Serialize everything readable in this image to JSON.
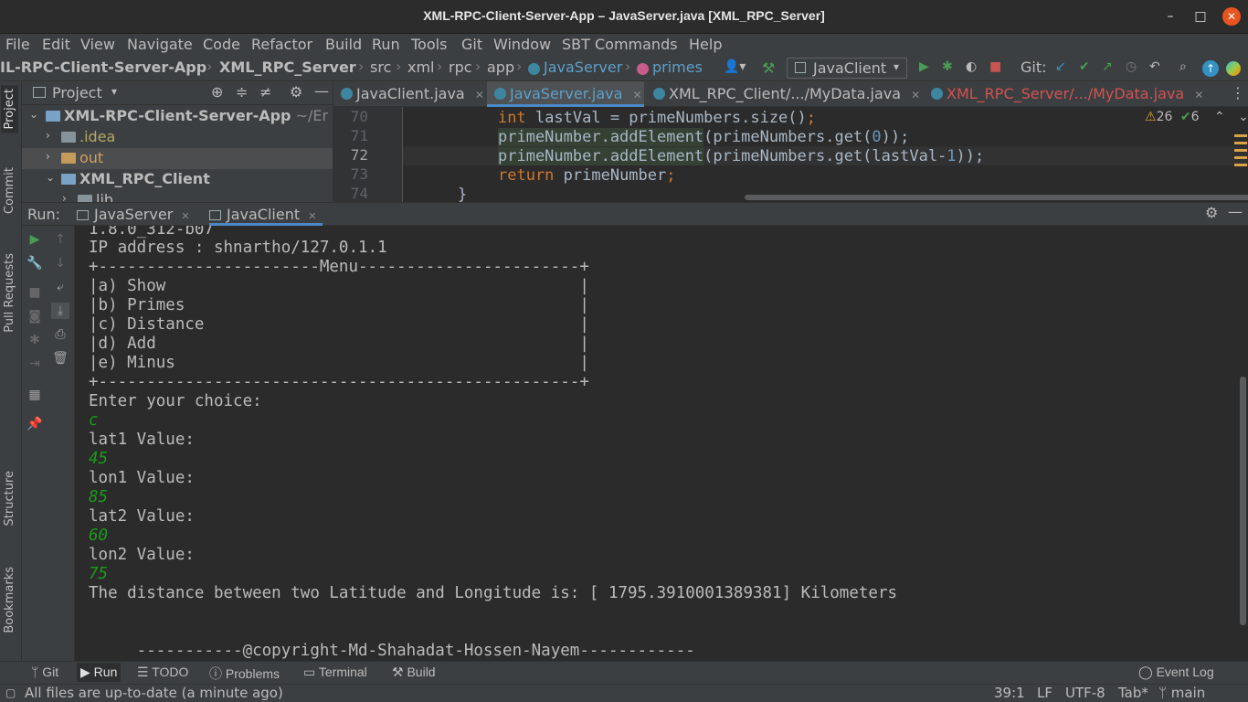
{
  "window": {
    "title": "XML-RPC-Client-Server-App – JavaServer.java [XML_RPC_Server]",
    "minimize": "–",
    "maximize": "□",
    "close": "✕"
  },
  "menu": [
    "File",
    "Edit",
    "View",
    "Navigate",
    "Code",
    "Refactor",
    "Build",
    "Run",
    "Tools",
    "Git",
    "Window",
    "SBT Commands",
    "Help"
  ],
  "breadcrumb": {
    "project": "IL-RPC-Client-Server-App",
    "module": "XML_RPC_Server",
    "parts": [
      "src",
      "xml",
      "rpc",
      "app"
    ],
    "class": "JavaServer",
    "method": "primes"
  },
  "toolbar": {
    "run_config": "JavaClient",
    "git_label": "Git:"
  },
  "left_tabs": [
    "Project",
    "Commit",
    "Pull Requests",
    "Structure",
    "Bookmarks"
  ],
  "project_panel": {
    "title": "Project",
    "tree": [
      {
        "label": "XML-RPC-Client-Server-App",
        "suffix": "~/Er",
        "bold": true,
        "expanded": true
      },
      {
        "label": ".idea",
        "expanded": false
      },
      {
        "label": "out",
        "expanded": false
      },
      {
        "label": "XML_RPC_Client",
        "bold": true,
        "expanded": true
      },
      {
        "label": "lib",
        "expanded": false
      }
    ]
  },
  "editor": {
    "tabs": [
      {
        "label": "JavaClient.java"
      },
      {
        "label": "JavaServer.java"
      },
      {
        "label": "XML_RPC_Client/.../MyData.java"
      },
      {
        "label": "XML_RPC_Server/.../MyData.java"
      }
    ],
    "line_numbers": [
      "70",
      "71",
      "72",
      "73",
      "74"
    ],
    "warnings": "26",
    "checks": "6",
    "lines": {
      "l70_kw": "int",
      "l70_rest": " lastVal = primeNumbers.size()",
      "l71_a": "primeNumber.addElement",
      "l71_b": "(primeNumbers.get(",
      "l71_num": "0",
      "l71_c": "));",
      "l72_a": "primeNumber.addElement",
      "l72_b": "(primeNumbers.get",
      "l72_c": "(lastVal-",
      "l72_num": "1",
      "l72_d": "));",
      "l73_kw": "return",
      "l73_rest": " primeNumber",
      "l74": "}"
    }
  },
  "run_panel": {
    "label": "Run:",
    "tabs": [
      "JavaServer",
      "JavaClient"
    ]
  },
  "console": {
    "lines": [
      {
        "text": "1.8.0_312-b07",
        "type": "out"
      },
      {
        "text": "IP address : shnartho/127.0.1.1",
        "type": "out"
      },
      {
        "text": "+-----------------------Menu-----------------------+",
        "type": "out"
      },
      {
        "text": "|a) Show                                           |",
        "type": "out"
      },
      {
        "text": "|b) Primes                                         |",
        "type": "out"
      },
      {
        "text": "|c) Distance                                       |",
        "type": "out"
      },
      {
        "text": "|d) Add                                            |",
        "type": "out"
      },
      {
        "text": "|e) Minus                                          |",
        "type": "out"
      },
      {
        "text": "+--------------------------------------------------+",
        "type": "out"
      },
      {
        "text": "Enter your choice:",
        "type": "out"
      },
      {
        "text": "c",
        "type": "in"
      },
      {
        "text": "lat1 Value:",
        "type": "out"
      },
      {
        "text": "45",
        "type": "in"
      },
      {
        "text": "lon1 Value:",
        "type": "out"
      },
      {
        "text": "85",
        "type": "in"
      },
      {
        "text": "lat2 Value:",
        "type": "out"
      },
      {
        "text": "60",
        "type": "in"
      },
      {
        "text": "lon2 Value:",
        "type": "out"
      },
      {
        "text": "75",
        "type": "in"
      },
      {
        "text": "The distance between two Latitude and Longitude is: [ 1795.3910001389381] Kilometers",
        "type": "out"
      },
      {
        "text": "",
        "type": "out"
      },
      {
        "text": "",
        "type": "out"
      },
      {
        "text": "     -----------@copyright-Md-Shahadat-Hossen-Nayem------------",
        "type": "out"
      }
    ]
  },
  "bottom_tabs": [
    "Git",
    "Run",
    "TODO",
    "Problems",
    "Terminal",
    "Build"
  ],
  "event_log": "Event Log",
  "status": {
    "message": "All files are up-to-date (a minute ago)",
    "position": "39:1",
    "line_sep": "LF",
    "encoding": "UTF-8",
    "indent": "Tab*",
    "branch": "main"
  }
}
